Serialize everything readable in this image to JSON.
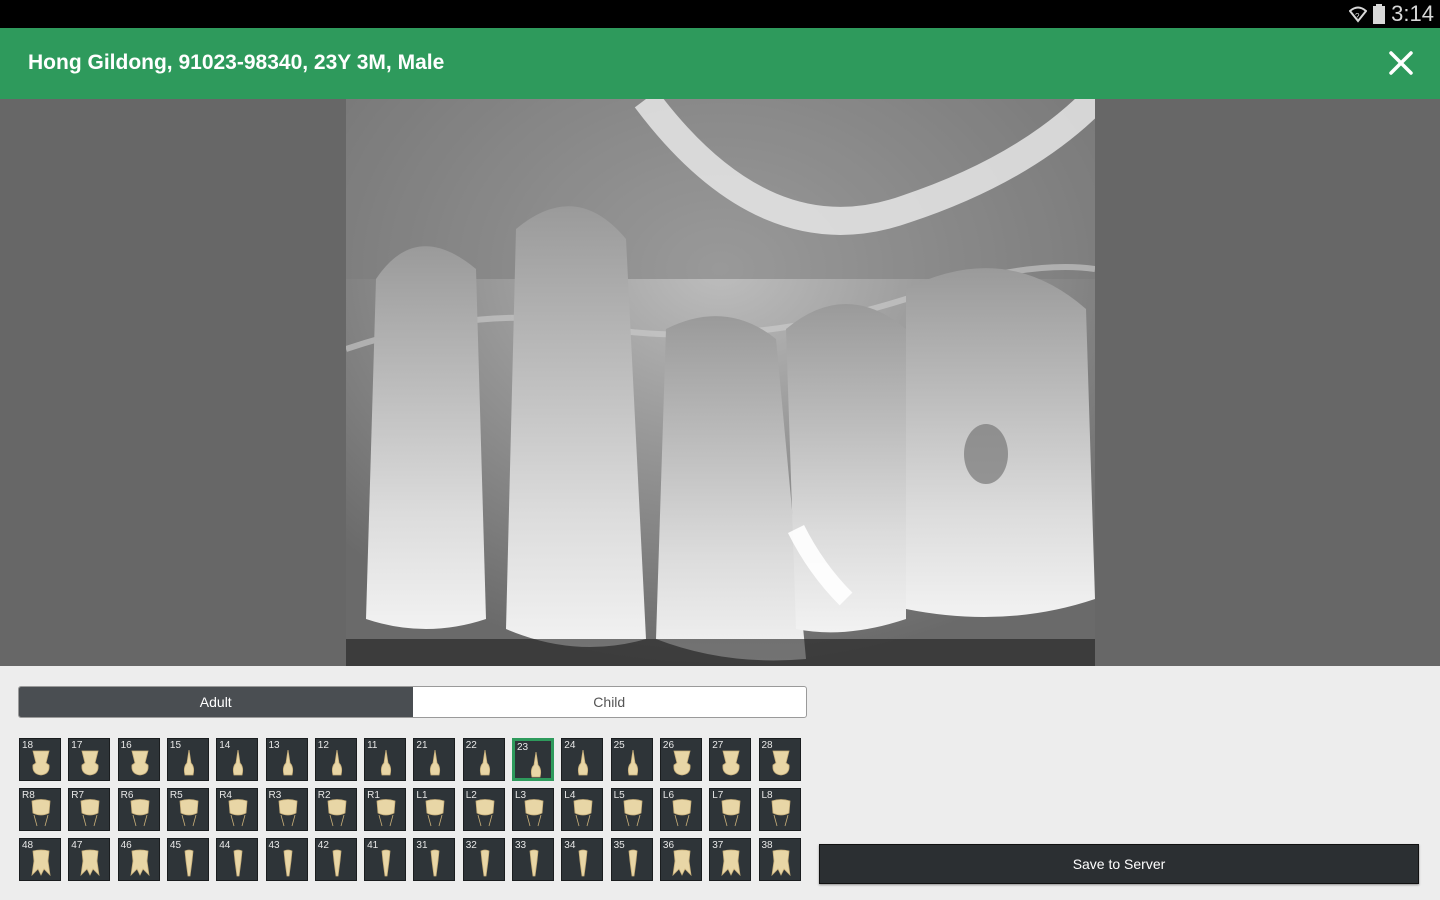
{
  "status_bar": {
    "time": "3:14",
    "icons": [
      "wifi-icon",
      "battery-icon"
    ]
  },
  "header": {
    "title": "Hong Gildong, 91023-98340, 23Y 3M, Male",
    "close_icon": "close-icon",
    "color": "#2e9a5c"
  },
  "viewer": {
    "image": "dental-xray"
  },
  "tooth_type_tabs": {
    "items": [
      "Adult",
      "Child"
    ],
    "selected": "Adult"
  },
  "tooth_grid": {
    "rows": [
      [
        "18",
        "17",
        "16",
        "15",
        "14",
        "13",
        "12",
        "11",
        "21",
        "22",
        "23",
        "24",
        "25",
        "26",
        "27",
        "28"
      ],
      [
        "R8",
        "R7",
        "R6",
        "R5",
        "R4",
        "R3",
        "R2",
        "R1",
        "L1",
        "L2",
        "L3",
        "L4",
        "L5",
        "L6",
        "L7",
        "L8"
      ],
      [
        "48",
        "47",
        "46",
        "45",
        "44",
        "43",
        "42",
        "41",
        "31",
        "32",
        "33",
        "34",
        "35",
        "36",
        "37",
        "38"
      ]
    ],
    "selected": "23"
  },
  "actions": {
    "save_label": "Save to Server"
  }
}
